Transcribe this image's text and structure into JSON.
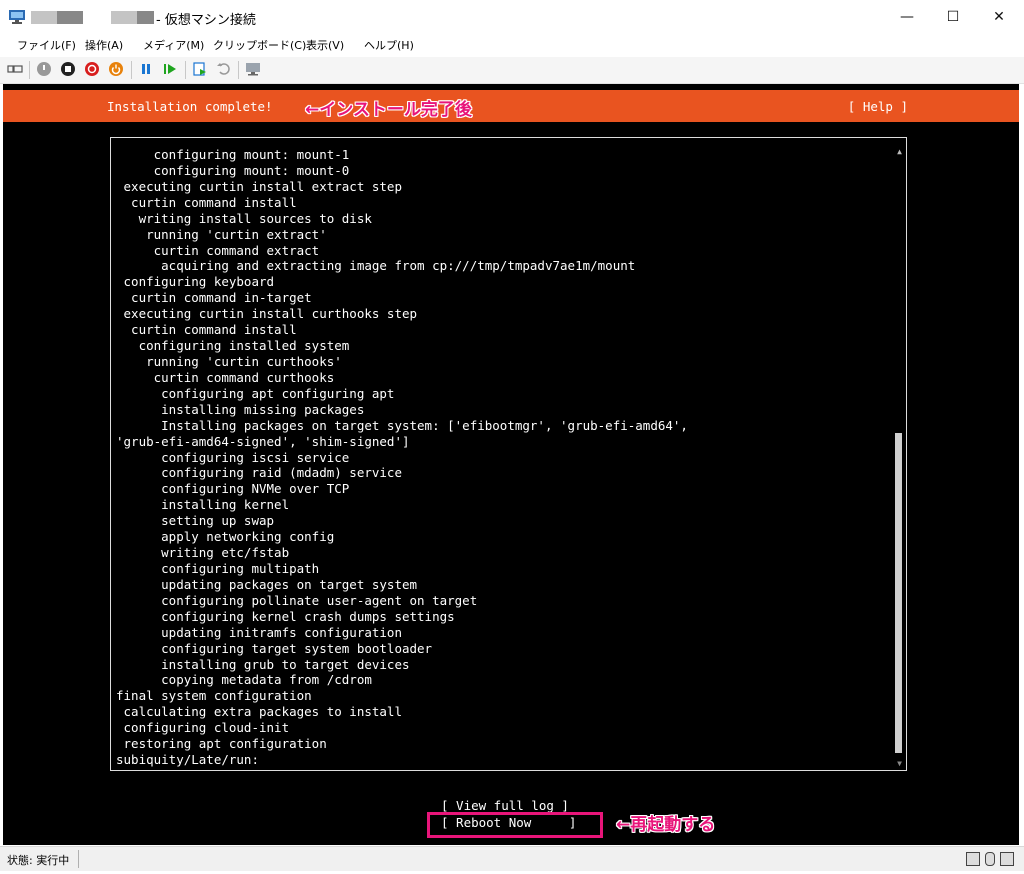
{
  "window": {
    "title": "- 仮想マシン接続",
    "min_symbol": "—",
    "max_symbol": "☐",
    "close_symbol": "✕"
  },
  "menu": [
    "ファイル(F)",
    "操作(A)",
    "メディア(M)",
    "クリップボード(C)",
    "表示(V)",
    "ヘルプ(H)"
  ],
  "toolbar": {
    "icons": [
      "ctrl-alt-del-icon",
      "start-icon",
      "turn-off-icon",
      "shut-down-icon",
      "power-icon",
      "pause-icon",
      "resume-icon",
      "checkpoint-icon",
      "revert-icon",
      "enhanced-session-icon"
    ]
  },
  "installer": {
    "header_title": "Installation complete!",
    "help": "[ Help ]",
    "log_lines": [
      "     configuring mount: mount-1",
      "     configuring mount: mount-0",
      " executing curtin install extract step",
      "  curtin command install",
      "   writing install sources to disk",
      "    running 'curtin extract'",
      "     curtin command extract",
      "      acquiring and extracting image from cp:///tmp/tmpadv7ae1m/mount",
      " configuring keyboard",
      "  curtin command in-target",
      " executing curtin install curthooks step",
      "  curtin command install",
      "   configuring installed system",
      "    running 'curtin curthooks'",
      "     curtin command curthooks",
      "      configuring apt configuring apt",
      "      installing missing packages",
      "      Installing packages on target system: ['efibootmgr', 'grub-efi-amd64',",
      "'grub-efi-amd64-signed', 'shim-signed']",
      "      configuring iscsi service",
      "      configuring raid (mdadm) service",
      "      configuring NVMe over TCP",
      "      installing kernel",
      "      setting up swap",
      "      apply networking config",
      "      writing etc/fstab",
      "      configuring multipath",
      "      updating packages on target system",
      "      configuring pollinate user-agent on target",
      "      configuring kernel crash dumps settings",
      "      updating initramfs configuration",
      "      configuring target system bootloader",
      "      installing grub to target devices",
      "      copying metadata from /cdrom",
      "final system configuration",
      " calculating extra packages to install",
      " configuring cloud-init",
      " restoring apt configuration",
      "subiquity/Late/run:"
    ],
    "view_log": "[ View full log ]",
    "reboot": "[ Reboot Now     ]"
  },
  "annotations": {
    "install_complete": "←インストール完了後",
    "reboot": "←再起動する"
  },
  "statusbar": {
    "status": "状態: 実行中"
  },
  "colors": {
    "header": "#e95420",
    "annotation": "#e8157a"
  }
}
